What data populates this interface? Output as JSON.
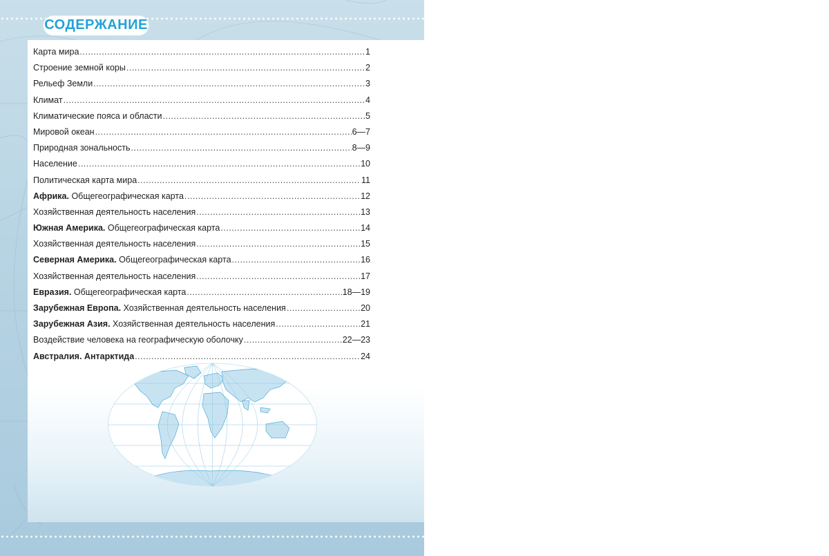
{
  "title": "СОДЕРЖАНИЕ",
  "toc": [
    {
      "bold": "",
      "text": "Карта мира",
      "page": "1"
    },
    {
      "bold": "",
      "text": "Строение земной коры",
      "page": "2"
    },
    {
      "bold": "",
      "text": "Рельеф Земли",
      "page": "3"
    },
    {
      "bold": "",
      "text": "Климат",
      "page": "4"
    },
    {
      "bold": "",
      "text": "Климатические пояса и области",
      "page": "5"
    },
    {
      "bold": "",
      "text": "Мировой океан",
      "page": "6—7"
    },
    {
      "bold": "",
      "text": "Природная зональность",
      "page": "8—9"
    },
    {
      "bold": "",
      "text": "Население",
      "page": "10"
    },
    {
      "bold": "",
      "text": "Политическая карта мира",
      "page": "11"
    },
    {
      "bold": "Африка.",
      "text": " Общегеографическая карта",
      "page": "12"
    },
    {
      "bold": "",
      "text": "Хозяйственная деятельность населения",
      "page": "13"
    },
    {
      "bold": "Южная Америка.",
      "text": " Общегеографическая карта",
      "page": "14"
    },
    {
      "bold": "",
      "text": "Хозяйственная деятельность населения",
      "page": "15"
    },
    {
      "bold": "Северная Америка.",
      "text": " Общегеографическая карта",
      "page": "16"
    },
    {
      "bold": "",
      "text": "Хозяйственная деятельность населения",
      "page": "17"
    },
    {
      "bold": "Евразия.",
      "text": " Общегеографическая карта",
      "page": "18—19"
    },
    {
      "bold": "Зарубежная Европа.",
      "text": " Хозяйственная деятельность населения",
      "page": "20"
    },
    {
      "bold": "Зарубежная Азия.",
      "text": " Хозяйственная деятельность населения",
      "page": "21"
    },
    {
      "bold": "",
      "text": "Воздействие человека на географическую оболочку",
      "page": "22—23"
    },
    {
      "bold": "Австралия. Антарктида",
      "text": "",
      "page": "24"
    }
  ],
  "colors": {
    "title": "#22a3d6",
    "map_water": "#ffffff",
    "map_land": "#c7e3f2",
    "map_lines": "#6fb9dd"
  }
}
